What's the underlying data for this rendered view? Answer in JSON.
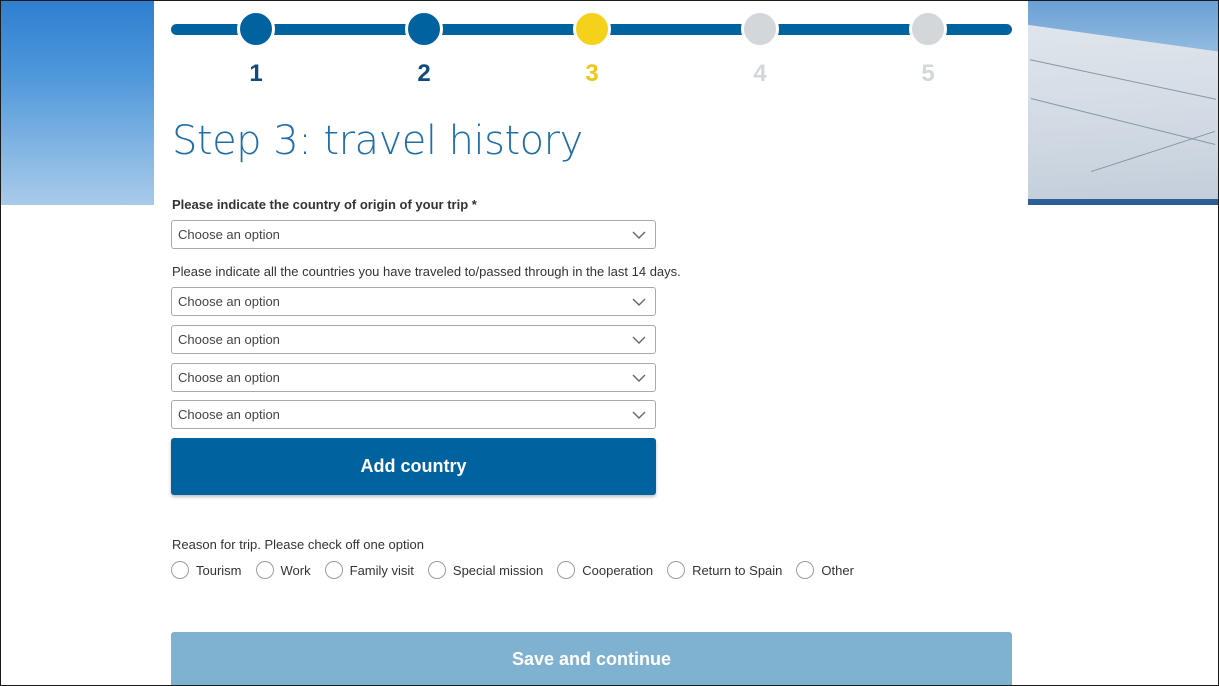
{
  "stepper": {
    "steps": [
      {
        "number": "1",
        "state": "done"
      },
      {
        "number": "2",
        "state": "done"
      },
      {
        "number": "3",
        "state": "current"
      },
      {
        "number": "4",
        "state": "todo"
      },
      {
        "number": "5",
        "state": "todo"
      }
    ]
  },
  "page": {
    "title": "Step 3: travel history"
  },
  "origin": {
    "label": "Please indicate the country of origin of your trip *",
    "select_value": "Choose an option"
  },
  "visited": {
    "label": "Please indicate all the countries you have traveled to/passed through in the last 14 days.",
    "selects": [
      "Choose an option",
      "Choose an option",
      "Choose an option",
      "Choose an option"
    ]
  },
  "actions": {
    "add_country_label": "Add country",
    "save_label": "Save and continue"
  },
  "reason": {
    "label": "Reason for trip. Please check off one option",
    "options": [
      "Tourism",
      "Work",
      "Family visit",
      "Special mission",
      "Cooperation",
      "Return to Spain",
      "Other"
    ]
  },
  "colors": {
    "primary": "#0063a0",
    "current_step": "#f4d21c",
    "pending_step": "#d4d7da",
    "save_disabled": "#7fb2d1",
    "title": "#1f6fa8"
  },
  "icons": {
    "select_arrow": "chevron-down-icon",
    "radio": "radio-circle-icon"
  }
}
